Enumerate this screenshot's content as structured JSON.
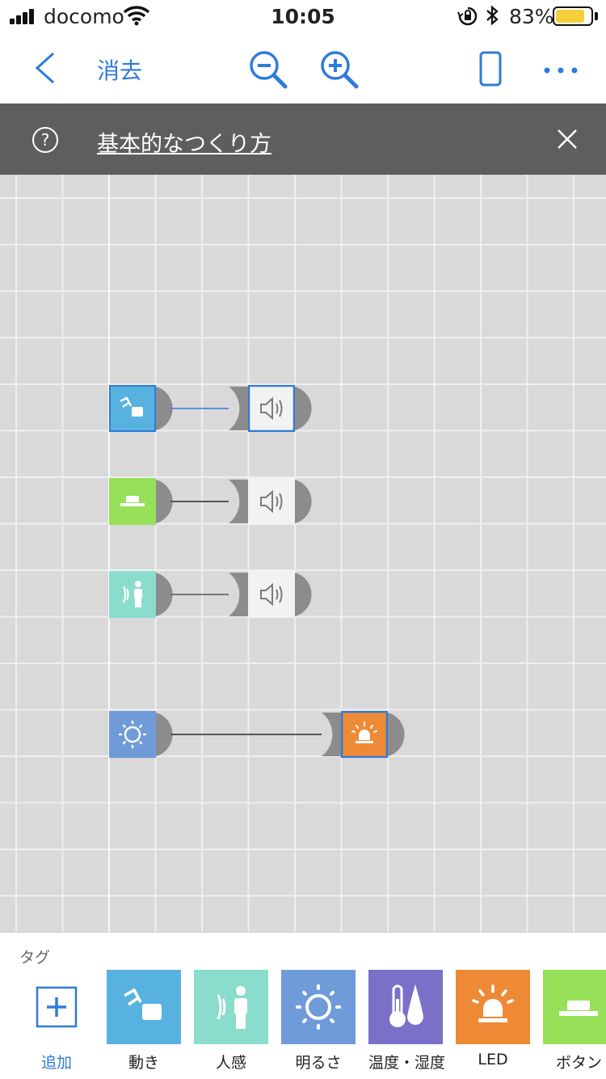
{
  "status_bar": {
    "carrier": "docomo",
    "time": "10:05",
    "battery_percent": "83%",
    "battery_level": 0.83
  },
  "navbar": {
    "back_icon": "chevron-left-icon",
    "erase_label": "消去",
    "zoom_out_icon": "zoom-out-icon",
    "zoom_in_icon": "zoom-in-icon",
    "device_icon": "phone-icon",
    "more_icon": "more-icon"
  },
  "banner": {
    "help_symbol": "?",
    "link_text": "基本的なつくり方",
    "close_icon": "close-icon"
  },
  "canvas": {
    "connections": [
      {
        "from": "motion",
        "to": "sound",
        "to_selected": true
      },
      {
        "from": "button",
        "to": "sound",
        "to_selected": false
      },
      {
        "from": "human-sensor",
        "to": "sound",
        "to_selected": false
      },
      {
        "from": "brightness",
        "to": "led",
        "to_selected": true
      }
    ]
  },
  "palette": {
    "section_label": "タグ",
    "items": [
      {
        "label": "追加",
        "icon": "plus-icon",
        "color": "#ffffff"
      },
      {
        "label": "動き",
        "icon": "motion-icon",
        "color": "#58b2e0"
      },
      {
        "label": "人感",
        "icon": "human-sensor-icon",
        "color": "#8adccd"
      },
      {
        "label": "明るさ",
        "icon": "brightness-icon",
        "color": "#6f9cd8"
      },
      {
        "label": "温度・湿度",
        "icon": "temperature-humidity-icon",
        "color": "#7a70c8"
      },
      {
        "label": "LED",
        "icon": "led-icon",
        "color": "#ee8a35"
      },
      {
        "label": "ボタン",
        "icon": "button-icon",
        "color": "#96e05a"
      }
    ]
  },
  "colors": {
    "accent": "#2e7bdc",
    "banner_bg": "#5e5e5e",
    "canvas_bg": "#d9d9d9",
    "motion": "#58b2e0",
    "human": "#8adccd",
    "brightness": "#6f9cd8",
    "temp": "#7a70c8",
    "led": "#ee8a35",
    "button": "#96e05a",
    "sound_bg": "#f2f2f2",
    "connector": "#8c8c8c"
  }
}
